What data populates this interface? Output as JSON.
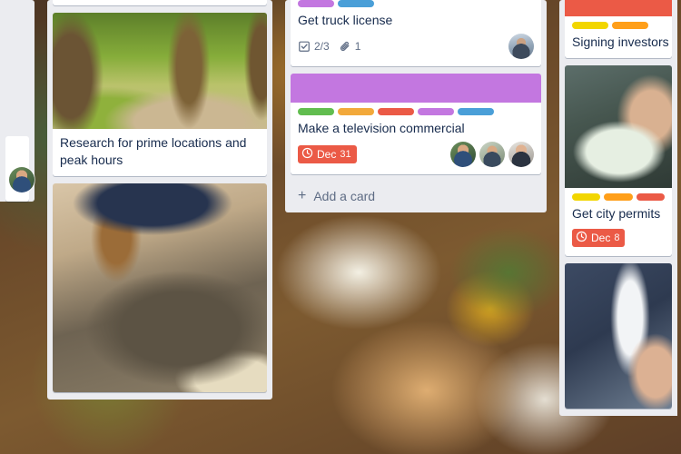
{
  "board": {
    "background_kind": "photo",
    "background_description": "food-photo"
  },
  "lists": [
    {
      "name": "list-partial-left",
      "visible": "partial",
      "cards": [
        {
          "title": "",
          "cover": "none",
          "labels": [],
          "badges": [],
          "members": [
            "avatar-a"
          ]
        }
      ]
    },
    {
      "name": "list-research",
      "visible": "partial",
      "cards": [
        {
          "title": "Research for prime locations and peak hours",
          "cover": "image-trees",
          "labels": [],
          "badges": [],
          "members": []
        },
        {
          "title": "",
          "cover": "image-room",
          "labels": [],
          "badges": [],
          "members": []
        }
      ]
    },
    {
      "name": "list-todo",
      "visible": "full",
      "cards": [
        {
          "title": "Get truck license",
          "cover": "none",
          "labels": [
            {
              "name": "purple",
              "color": "#c377e0"
            },
            {
              "name": "blue",
              "color": "#4a9fd8"
            }
          ],
          "badges": [
            {
              "name": "checklist",
              "icon": "checklist-icon",
              "text": "2/3"
            },
            {
              "name": "attachment",
              "icon": "paperclip-icon",
              "text": "1"
            }
          ],
          "members": [
            "avatar-b"
          ]
        },
        {
          "title": "Make a television commercial",
          "cover": "color-purple",
          "cover_color": "#c377e0",
          "labels": [
            {
              "name": "green",
              "color": "#61bd4f"
            },
            {
              "name": "yellow-orange",
              "color": "#f2a93b"
            },
            {
              "name": "red",
              "color": "#eb5a46"
            },
            {
              "name": "purple",
              "color": "#c377e0"
            },
            {
              "name": "blue",
              "color": "#4a9fd8"
            }
          ],
          "due": {
            "icon": "clock-icon",
            "month": "Dec",
            "day": "31",
            "color": "#eb5a46"
          },
          "members": [
            "avatar-a",
            "avatar-b",
            "avatar-c"
          ]
        }
      ],
      "add_card_label": "Add a card",
      "add_card_icon": "plus-icon"
    },
    {
      "name": "list-doing",
      "visible": "partial",
      "cards": [
        {
          "title": "Signing investors",
          "cover": "color-red",
          "cover_color": "#eb5a46",
          "labels": [
            {
              "name": "yellow",
              "color": "#f2d600"
            },
            {
              "name": "orange",
              "color": "#ff9f1a"
            }
          ],
          "badges": [],
          "members": []
        },
        {
          "title": "Get city permits",
          "cover": "image-writing",
          "labels": [
            {
              "name": "yellow",
              "color": "#f2d600"
            },
            {
              "name": "orange",
              "color": "#ff9f1a"
            },
            {
              "name": "red",
              "color": "#eb5a46"
            }
          ],
          "due": {
            "icon": "clock-icon",
            "month": "Dec",
            "day": "8",
            "color": "#eb5a46"
          },
          "members": []
        },
        {
          "title": "",
          "cover": "image-handshake",
          "labels": [],
          "badges": [],
          "members": []
        }
      ]
    }
  ],
  "colors": {
    "list_background": "#ebecf0",
    "card_background": "#ffffff",
    "card_text": "#172b4d",
    "muted_text": "#5e6c84",
    "due_red": "#eb5a46",
    "label_green": "#61bd4f",
    "label_yellow": "#f2d600",
    "label_orange": "#ff9f1a",
    "label_red": "#eb5a46",
    "label_purple": "#c377e0",
    "label_blue": "#4a9fd8"
  }
}
